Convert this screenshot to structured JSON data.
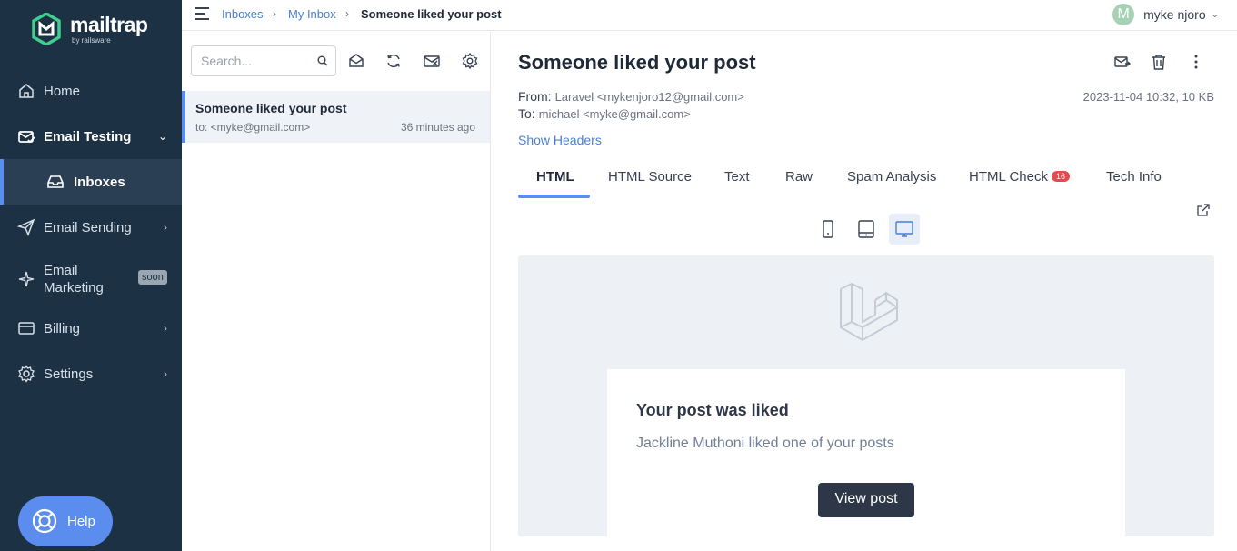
{
  "brand": {
    "name": "mailtrap",
    "sub": "by railsware",
    "accent": "#5b8def",
    "sidebar_bg": "#1c3144"
  },
  "sidebar": {
    "items": [
      {
        "label": "Home",
        "icon": "home-icon"
      },
      {
        "label": "Email Testing",
        "icon": "email-testing-icon",
        "active": true,
        "expanded": true
      },
      {
        "label": "Inboxes",
        "icon": "inbox-icon",
        "selected": true
      },
      {
        "label": "Email Sending",
        "icon": "send-icon"
      },
      {
        "label": "Email",
        "label2": "Marketing",
        "badge": "soon",
        "icon": "sparkle-icon"
      },
      {
        "label": "Billing",
        "icon": "credit-card-icon"
      },
      {
        "label": "Settings",
        "icon": "gear-icon"
      }
    ],
    "help_label": "Help"
  },
  "breadcrumb": {
    "items": [
      "Inboxes",
      "My Inbox"
    ],
    "current": "Someone liked your post"
  },
  "user": {
    "initial": "M",
    "name": "myke njoro"
  },
  "list": {
    "search_placeholder": "Search...",
    "messages": [
      {
        "subject": "Someone liked your post",
        "to": "to: <myke@gmail.com>",
        "time": "36 minutes ago"
      }
    ]
  },
  "message": {
    "subject": "Someone liked your post",
    "from_label": "From:",
    "from": "Laravel <mykenjoro12@gmail.com>",
    "to_label": "To:",
    "to": "michael <myke@gmail.com>",
    "date_size": "2023-11-04 10:32, 10 KB",
    "show_headers": "Show Headers",
    "tabs": [
      "HTML",
      "HTML Source",
      "Text",
      "Raw",
      "Spam Analysis",
      "HTML Check",
      "Tech Info"
    ],
    "html_check_count": "16",
    "active_tab": "HTML",
    "active_device": "desktop"
  },
  "email_body": {
    "title": "Your post was liked",
    "text": "Jackline Muthoni liked one of your posts",
    "button": "View post"
  }
}
